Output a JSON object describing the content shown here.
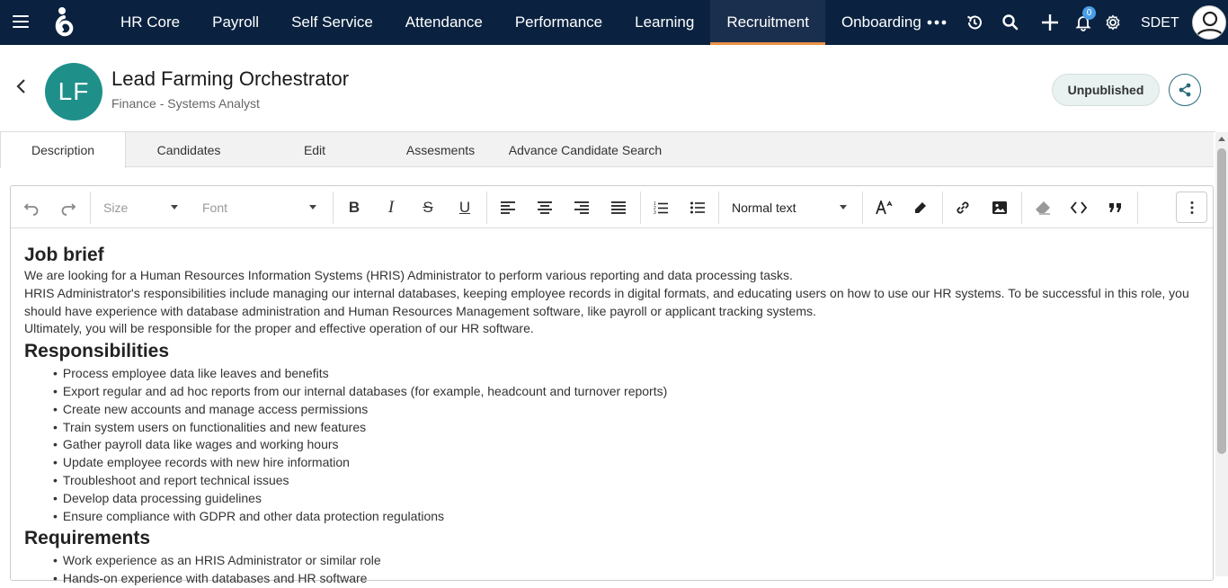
{
  "nav": {
    "items": [
      "HR Core",
      "Payroll",
      "Self Service",
      "Attendance",
      "Performance",
      "Learning",
      "Recruitment",
      "Onboarding"
    ],
    "active": "Recruitment",
    "notification_count": "0",
    "user": "SDET"
  },
  "job": {
    "initials": "LF",
    "title": "Lead Farming Orchestrator",
    "subtitle": "Finance - Systems Analyst",
    "status": "Unpublished",
    "avatar_color": "#1f8f8a"
  },
  "tabs": {
    "items": [
      "Description",
      "Candidates",
      "Edit",
      "Assesments",
      "Advance Candidate Search"
    ],
    "active": "Description"
  },
  "toolbar": {
    "size_placeholder": "Size",
    "font_placeholder": "Font",
    "block_style": "Normal text"
  },
  "content": {
    "job_brief_heading": "Job brief",
    "job_brief_paragraphs": [
      "We are looking for a Human Resources Information Systems (HRIS) Administrator to perform various reporting and data processing tasks.",
      "HRIS Administrator's responsibilities include managing our internal databases, keeping employee records in digital formats, and educating users on how to use our HR systems. To be successful in this role, you should have experience with database administration and Human Resources Management software, like payroll or applicant tracking systems.",
      "Ultimately, you will be responsible for the proper and effective operation of our HR software."
    ],
    "responsibilities_heading": "Responsibilities",
    "responsibilities": [
      "Process employee data like leaves and benefits",
      "Export regular and ad hoc reports from our internal databases (for example, headcount and turnover reports)",
      "Create new accounts and manage access permissions",
      "Train system users on functionalities and new features",
      "Gather payroll data like wages and working hours",
      "Update employee records with new hire information",
      "Troubleshoot and report technical issues",
      "Develop data processing guidelines",
      "Ensure compliance with GDPR and other data protection regulations"
    ],
    "requirements_heading": "Requirements",
    "requirements": [
      "Work experience as an HRIS Administrator or similar role",
      "Hands-on experience with databases and HR software"
    ]
  }
}
